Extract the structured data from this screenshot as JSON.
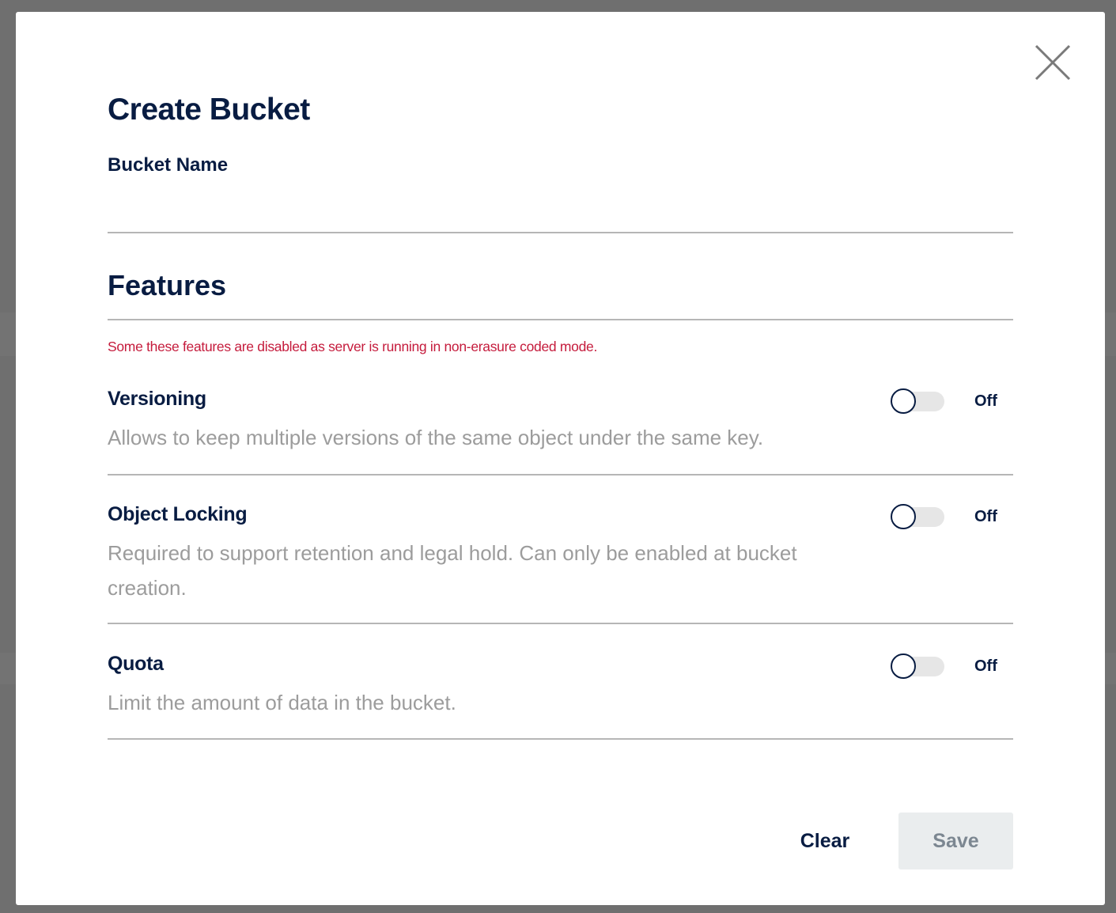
{
  "dialog": {
    "title": "Create Bucket",
    "bucket_name_label": "Bucket Name",
    "bucket_name_value": "",
    "bucket_name_placeholder": ""
  },
  "features": {
    "title": "Features",
    "warning": "Some these features are disabled as server is running in non-erasure coded mode.",
    "items": [
      {
        "name": "Versioning",
        "description": "Allows to keep multiple versions of the same object under the same key.",
        "enabled": false,
        "state_label": "Off"
      },
      {
        "name": "Object Locking",
        "description": "Required to support retention and legal hold. Can only be enabled at bucket creation.",
        "enabled": false,
        "state_label": "Off"
      },
      {
        "name": "Quota",
        "description": "Limit the amount of data in the bucket.",
        "enabled": false,
        "state_label": "Off"
      }
    ]
  },
  "actions": {
    "clear_label": "Clear",
    "save_label": "Save"
  },
  "icons": {
    "close": "close-icon"
  },
  "colors": {
    "heading": "#081c42",
    "warning": "#c51b3c",
    "description": "#9c9c9c",
    "save_button_bg": "#eaedee",
    "save_button_text": "#7c8791",
    "overlay": "#6f6f6f"
  }
}
